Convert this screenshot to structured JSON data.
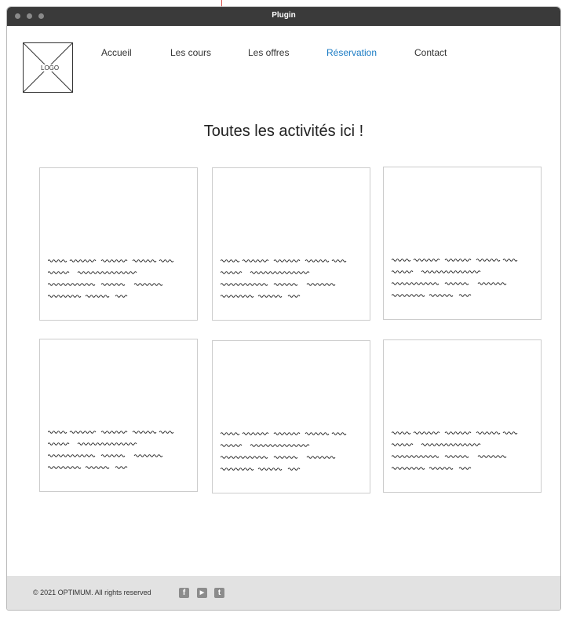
{
  "window": {
    "title": "Plugin"
  },
  "logo": {
    "label": "LOGO"
  },
  "nav": {
    "items": [
      {
        "label": "Accueil"
      },
      {
        "label": "Les cours"
      },
      {
        "label": "Les offres"
      },
      {
        "label": "Réservation"
      },
      {
        "label": "Contact"
      }
    ],
    "active_color": "#1a7bc4"
  },
  "main": {
    "heading": "Toutes les activités ici !"
  },
  "cards": [
    {
      "text": "placeholder-scribble"
    },
    {
      "text": "placeholder-scribble"
    },
    {
      "text": "placeholder-scribble"
    },
    {
      "text": "placeholder-scribble"
    },
    {
      "text": "placeholder-scribble"
    },
    {
      "text": "placeholder-scribble"
    }
  ],
  "footer": {
    "copyright": "© 2021 OPTIMUM. All rights reserved",
    "social": [
      {
        "icon": "facebook-icon",
        "glyph": "f"
      },
      {
        "icon": "youtube-icon",
        "glyph": "▶"
      },
      {
        "icon": "twitter-icon",
        "glyph": "t"
      }
    ]
  }
}
